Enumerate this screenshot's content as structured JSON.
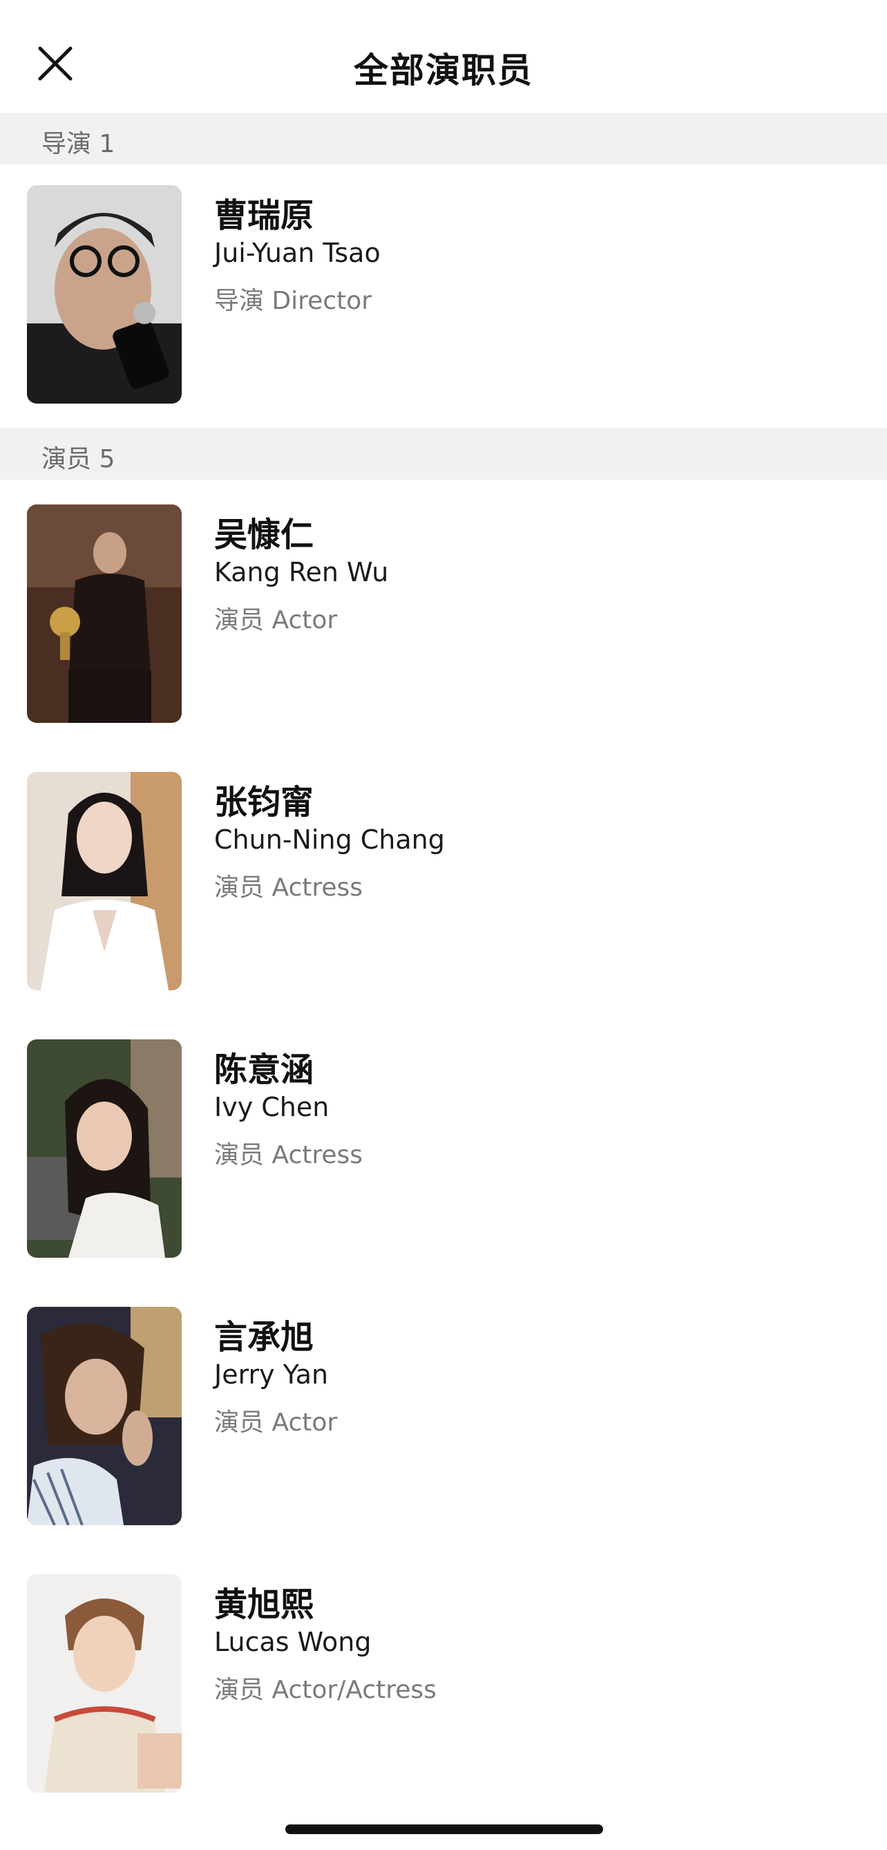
{
  "header": {
    "title": "全部演职员",
    "close_icon": "close-icon"
  },
  "sections": [
    {
      "label": "导演 1",
      "people": [
        {
          "cn": "曹瑞原",
          "en": "Jui-Yuan Tsao",
          "role": "导演 Director"
        }
      ]
    },
    {
      "label": "演员 5",
      "people": [
        {
          "cn": "吴慷仁",
          "en": "Kang Ren Wu",
          "role": "演员 Actor"
        },
        {
          "cn": "张钧甯",
          "en": "Chun-Ning Chang",
          "role": "演员 Actress"
        },
        {
          "cn": "陈意涵",
          "en": "Ivy Chen",
          "role": "演员 Actress"
        },
        {
          "cn": "言承旭",
          "en": "Jerry Yan",
          "role": "演员 Actor"
        },
        {
          "cn": "黄旭熙",
          "en": "Lucas Wong",
          "role": "演员 Actor/Actress"
        }
      ]
    }
  ],
  "colors": {
    "section_bg": "#f1f1f2",
    "section_text": "#6b6b6b",
    "role_text": "#7a7a7a",
    "title_text": "#111111"
  }
}
